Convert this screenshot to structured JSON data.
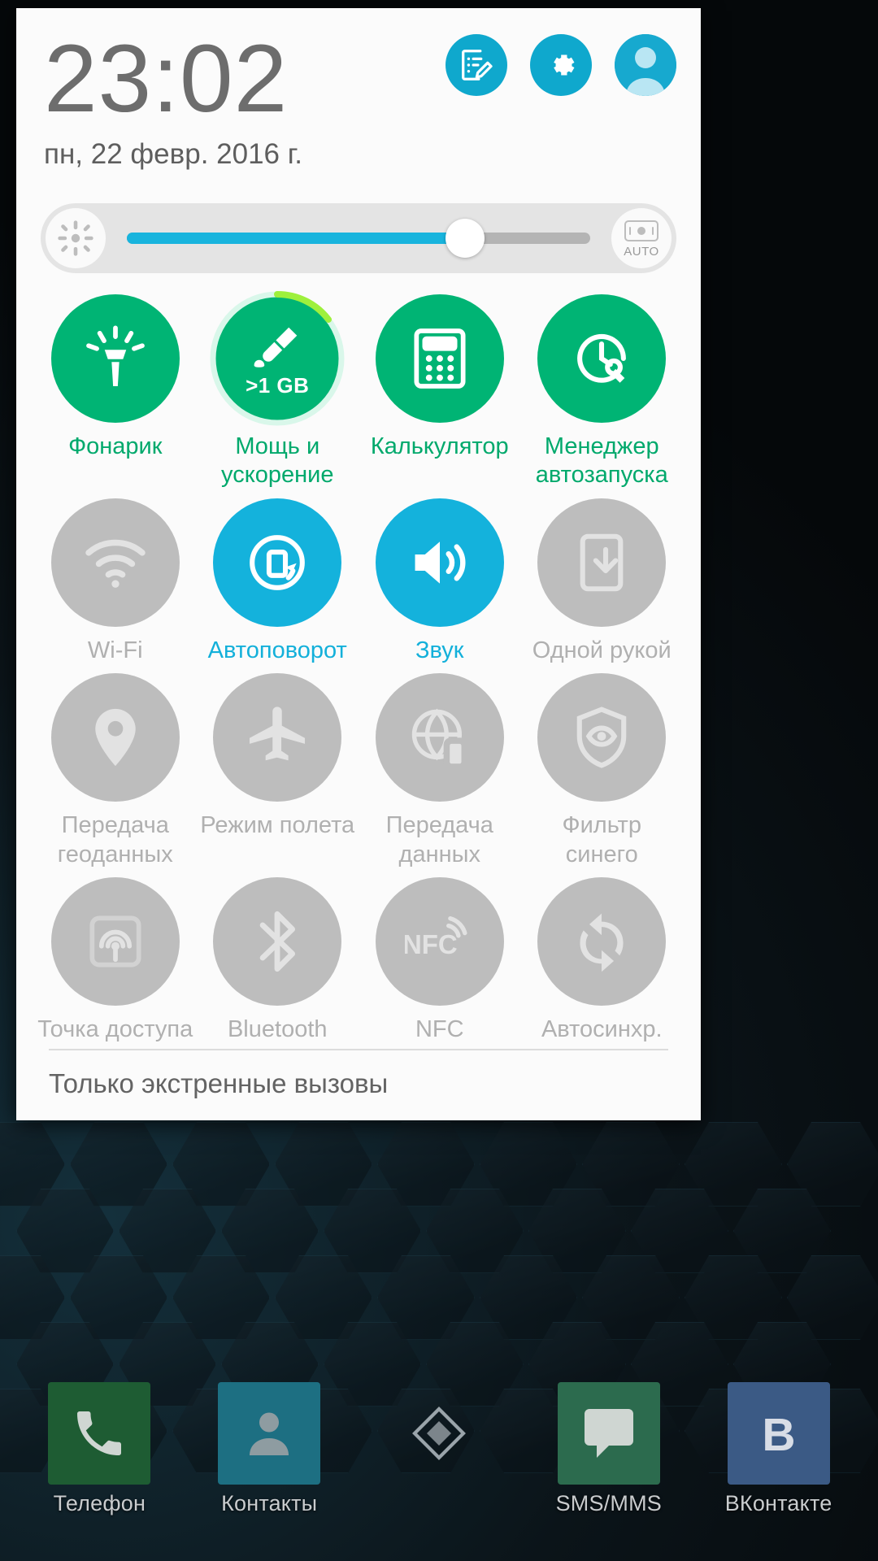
{
  "header": {
    "clock": "23:02",
    "date": "пн, 22 февр. 2016 г.",
    "actions": [
      {
        "name": "notes-edit-icon",
        "label": "Заметки"
      },
      {
        "name": "gear-icon",
        "label": "Настройки"
      },
      {
        "name": "user-avatar",
        "label": "Пользователь"
      }
    ]
  },
  "brightness": {
    "icon": "brightness-sun-icon",
    "value_percent": 73,
    "auto_label": "AUTO",
    "auto_icon": "auto-brightness-icon"
  },
  "tiles": [
    {
      "label": "Фонарик",
      "icon": "flashlight-icon",
      "state": "green"
    },
    {
      "label": "Мощь и ускорение",
      "icon": "boost-brush-icon",
      "state": "green",
      "badge": ">1 GB",
      "arc_percent": 22
    },
    {
      "label": "Калькулятор",
      "icon": "calculator-icon",
      "state": "green"
    },
    {
      "label": "Менеджер автозапуска",
      "icon": "autostart-icon",
      "state": "green"
    },
    {
      "label": "Wi-Fi",
      "icon": "wifi-icon",
      "state": "off"
    },
    {
      "label": "Автоповорот",
      "icon": "autorotate-icon",
      "state": "cyan"
    },
    {
      "label": "Звук",
      "icon": "sound-icon",
      "state": "cyan"
    },
    {
      "label": "Одной рукой",
      "icon": "one-hand-icon",
      "state": "off"
    },
    {
      "label": "Передача геоданных",
      "icon": "location-pin-icon",
      "state": "off"
    },
    {
      "label": "Режим полета",
      "icon": "airplane-icon",
      "state": "off"
    },
    {
      "label": "Передача данных",
      "icon": "mobile-data-icon",
      "state": "off"
    },
    {
      "label": "Фильтр синего",
      "icon": "blue-filter-icon",
      "state": "off"
    },
    {
      "label": "Точка доступа",
      "icon": "hotspot-icon",
      "state": "off"
    },
    {
      "label": "Bluetooth",
      "icon": "bluetooth-icon",
      "state": "off"
    },
    {
      "label": "NFC",
      "icon": "nfc-icon",
      "state": "off"
    },
    {
      "label": "Автосинхр.",
      "icon": "autosync-icon",
      "state": "off"
    }
  ],
  "footer": {
    "status_text": "Только экстренные вызовы"
  },
  "dock": [
    {
      "label": "Телефон",
      "icon": "phone-icon"
    },
    {
      "label": "Контакты",
      "icon": "contacts-icon"
    },
    {
      "label": "",
      "icon": "diamond-icon"
    },
    {
      "label": "SMS/MMS",
      "icon": "sms-icon"
    },
    {
      "label": "ВКонтакте",
      "icon": "vk-icon"
    }
  ],
  "colors": {
    "accent_cyan": "#14b2dc",
    "accent_green": "#00b474",
    "tile_off": "#bdbdbd",
    "panel_bg": "#fbfbfb",
    "arc_lime": "#9ef03c"
  }
}
